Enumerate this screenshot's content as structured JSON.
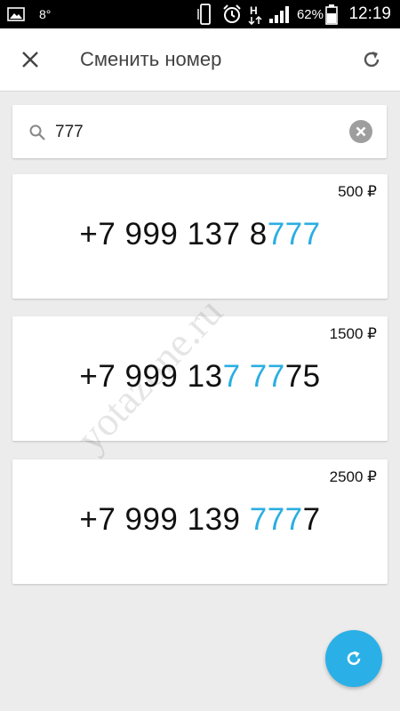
{
  "status_bar": {
    "temperature": "8°",
    "network_type": "H",
    "battery_percent": "62%",
    "time": "12:19",
    "icons": [
      "image-icon",
      "phone-icon",
      "alarm-icon",
      "network-h-icon",
      "signal-icon",
      "battery-icon"
    ]
  },
  "app_bar": {
    "title": "Сменить номер",
    "close_icon": "close-icon",
    "refresh_icon": "refresh-icon"
  },
  "search": {
    "value": "777",
    "icon": "search-icon",
    "clear_icon": "clear-icon"
  },
  "numbers": [
    {
      "price": "500 ₽",
      "prefix": "+7 999 137 8",
      "highlight": "777",
      "suffix": ""
    },
    {
      "price": "1500 ₽",
      "prefix": "+7 999 13",
      "highlight": "7 77",
      "suffix": "75"
    },
    {
      "price": "2500 ₽",
      "prefix": "+7 999 139 ",
      "highlight": "777",
      "suffix": "7"
    }
  ],
  "watermark": "yotazone.ru",
  "fab": {
    "icon": "refresh-icon"
  },
  "colors": {
    "accent": "#2aaee2",
    "background": "#ececec",
    "status_bar": "#000000"
  }
}
